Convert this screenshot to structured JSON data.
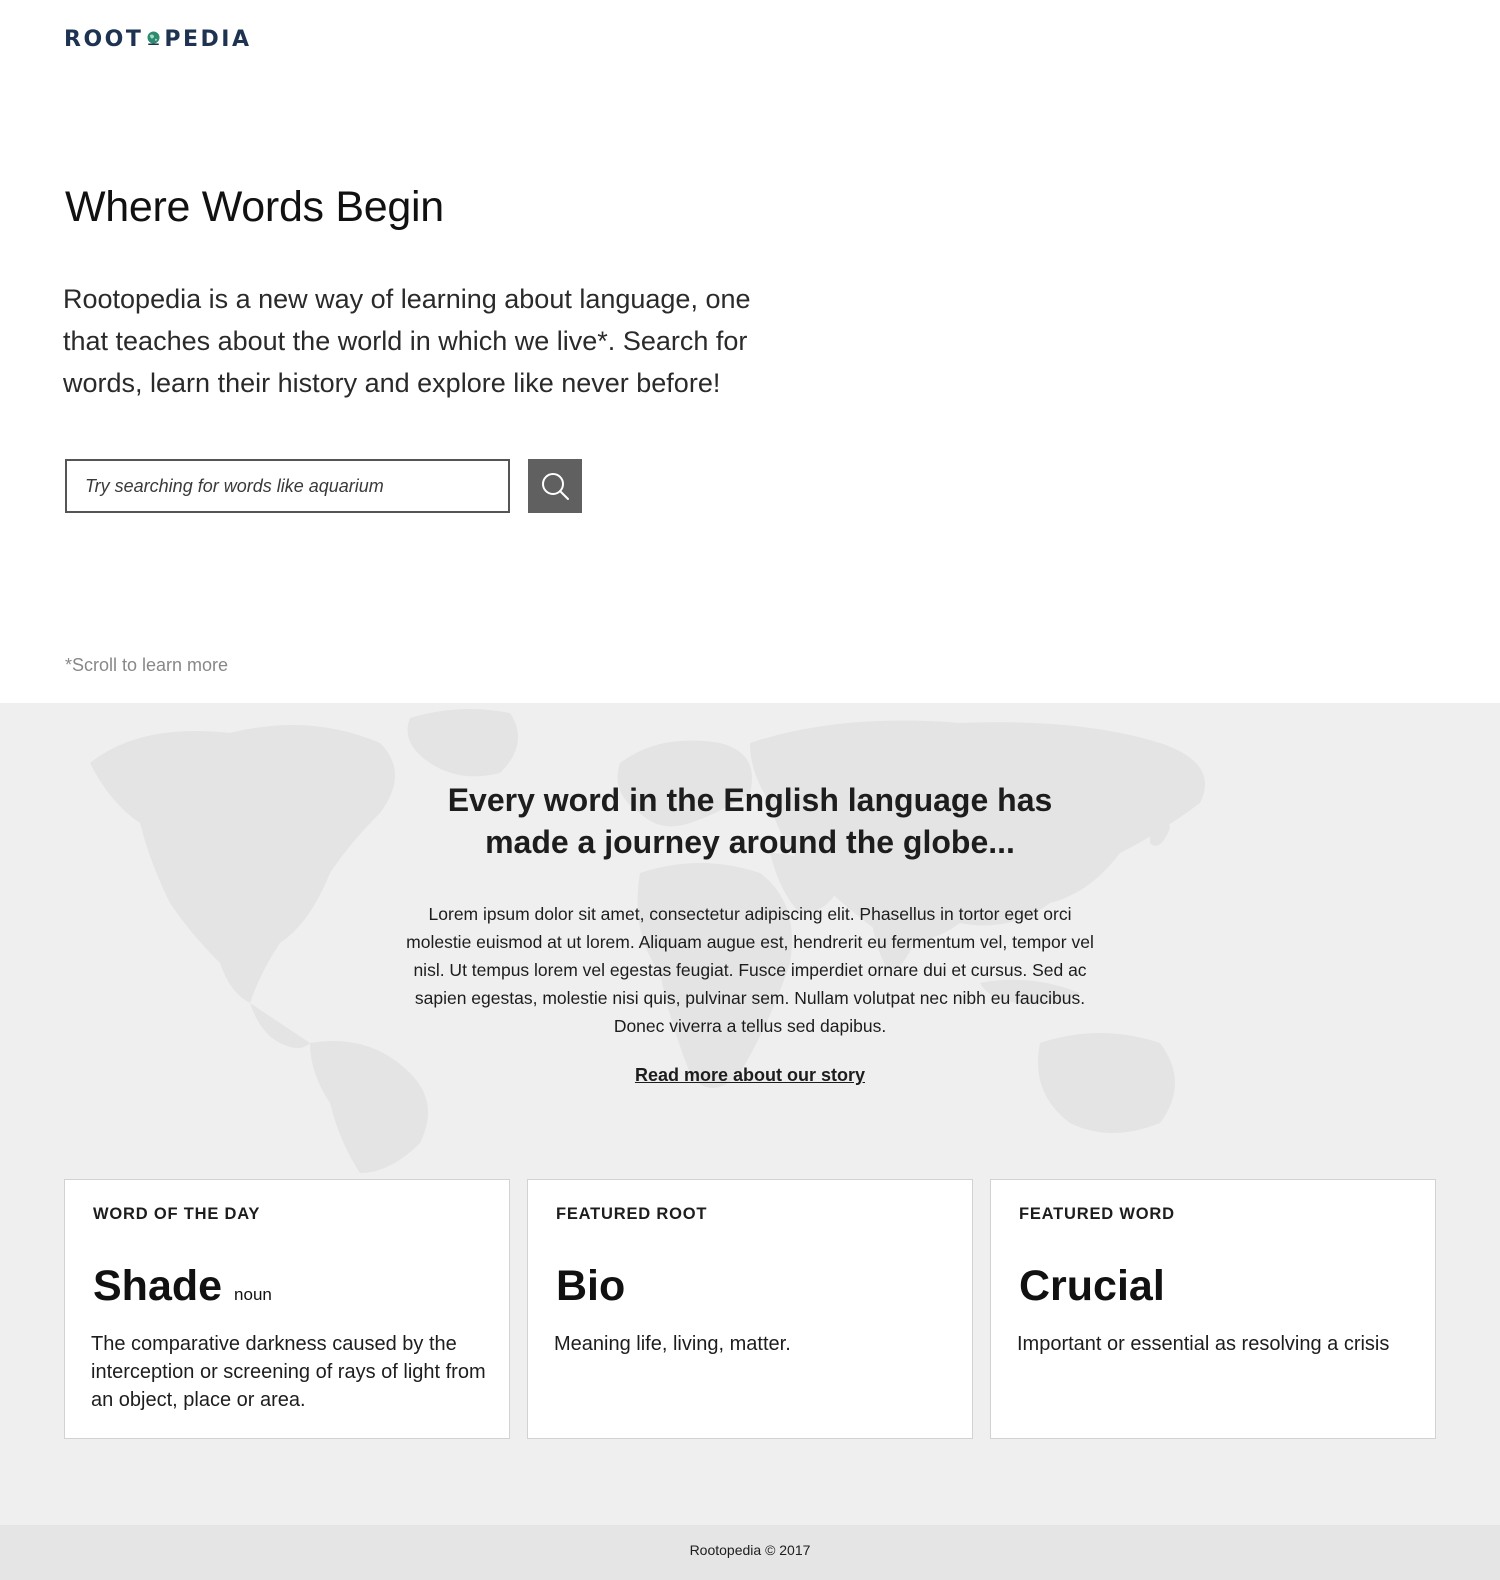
{
  "brand": {
    "logo_left": "ROOT",
    "logo_right": "PEDIA",
    "logo_colors": {
      "text": "#1e3352",
      "globe": "#2e8b6f"
    }
  },
  "hero": {
    "title": "Where Words Begin",
    "description": "Rootopedia is a new way of learning about language, one that teaches about the world in which we live*.  Search for words, learn their history and explore like never before!",
    "search": {
      "placeholder": "Try searching for words like aquarium",
      "value": "",
      "button_icon": "search-icon"
    },
    "scroll_note": "*Scroll to learn more"
  },
  "story": {
    "title_line1": "Every word in the English language has",
    "title_line2": "made a journey around the globe...",
    "body": "Lorem ipsum dolor sit amet, consectetur adipiscing elit. Phasellus in tortor eget orci molestie euismod at ut lorem. Aliquam augue est, hendrerit eu fermentum vel, tempor vel nisl. Ut tempus lorem vel egestas feugiat. Fusce imperdiet ornare dui et cursus. Sed ac sapien egestas, molestie nisi quis, pulvinar sem. Nullam volutpat nec nibh eu faucibus. Donec viverra a tellus sed dapibus.",
    "link": "Read more about our story",
    "background_icon": "world-map-icon"
  },
  "cards": [
    {
      "label": "WORD OF THE DAY",
      "word": "Shade",
      "part_of_speech": "noun",
      "definition": "The comparative darkness caused by the interception or screening of rays of light from an object, place or area."
    },
    {
      "label": "FEATURED ROOT",
      "word": "Bio",
      "part_of_speech": "",
      "definition": "Meaning  life, living, matter."
    },
    {
      "label": "FEATURED WORD",
      "word": "Crucial",
      "part_of_speech": "",
      "definition": "Important or essential as resolving a crisis"
    }
  ],
  "footer": {
    "text": "Rootopedia © 2017"
  },
  "colors": {
    "search_button": "#606060",
    "section_bg": "#efefef",
    "footer_bg": "#e5e5e5",
    "map_fill": "#e4e4e4"
  }
}
